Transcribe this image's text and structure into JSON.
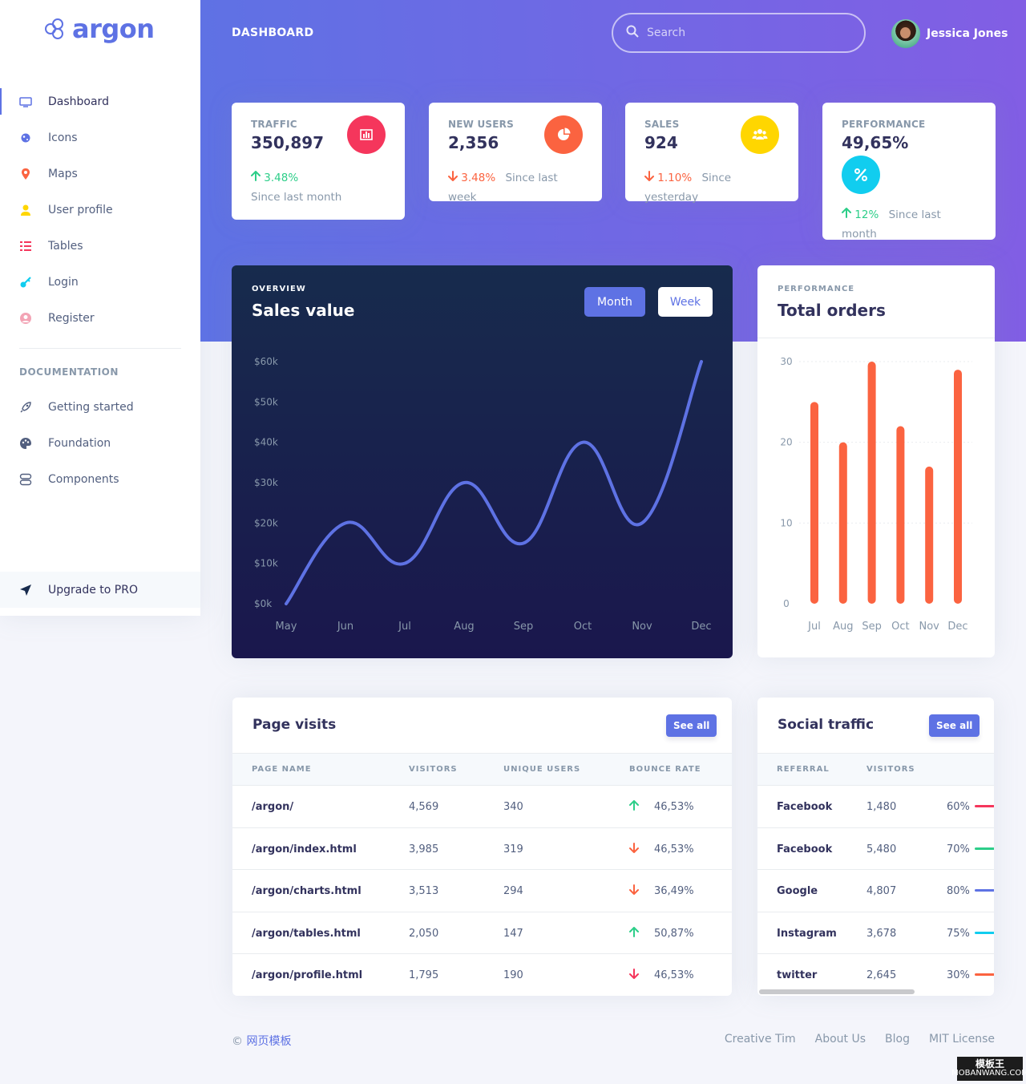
{
  "brand": {
    "name": "argon"
  },
  "sidebar": {
    "items": [
      {
        "label": "Dashboard",
        "icon": "tv-icon",
        "color": "#5e72e4",
        "active": true
      },
      {
        "label": "Icons",
        "icon": "planet-icon",
        "color": "#5e72e4"
      },
      {
        "label": "Maps",
        "icon": "pin-icon",
        "color": "#fb6340"
      },
      {
        "label": "User profile",
        "icon": "user-icon",
        "color": "#ffd600"
      },
      {
        "label": "Tables",
        "icon": "list-icon",
        "color": "#f5365c"
      },
      {
        "label": "Login",
        "icon": "key-icon",
        "color": "#11cdef"
      },
      {
        "label": "Register",
        "icon": "circle-user-icon",
        "color": "#f3a4b5"
      }
    ],
    "doc_heading": "DOCUMENTATION",
    "doc_items": [
      {
        "label": "Getting started",
        "icon": "rocket-icon"
      },
      {
        "label": "Foundation",
        "icon": "palette-icon"
      },
      {
        "label": "Components",
        "icon": "components-icon"
      }
    ],
    "upgrade": "Upgrade to PRO"
  },
  "header": {
    "title": "DASHBOARD",
    "search_placeholder": "Search",
    "user_name": "Jessica Jones"
  },
  "stats": [
    {
      "title": "TRAFFIC",
      "value": "350,897",
      "change": "3.48%",
      "direction": "up",
      "since": "Since last month",
      "icon": "chart-bar-icon",
      "color": "#f5365c"
    },
    {
      "title": "NEW USERS",
      "value": "2,356",
      "change": "3.48%",
      "direction": "down",
      "since": "Since last week",
      "icon": "chart-pie-icon",
      "color": "#fb6340"
    },
    {
      "title": "SALES",
      "value": "924",
      "change": "1.10%",
      "direction": "down",
      "since": "Since yesterday",
      "icon": "users-icon",
      "color": "#ffd600"
    },
    {
      "title": "PERFORMANCE",
      "value": "49,65%",
      "change": "12%",
      "direction": "up",
      "since": "Since last month",
      "icon": "percent-icon",
      "color": "#11cdef"
    }
  ],
  "sales_card": {
    "kicker": "OVERVIEW",
    "title": "Sales value",
    "btn_month": "Month",
    "btn_week": "Week"
  },
  "orders_card": {
    "kicker": "PERFORMANCE",
    "title": "Total orders"
  },
  "chart_data": [
    {
      "type": "line",
      "title": "Sales value",
      "categories": [
        "May",
        "Jun",
        "Jul",
        "Aug",
        "Sep",
        "Oct",
        "Nov",
        "Dec"
      ],
      "values": [
        0,
        20,
        10,
        30,
        15,
        40,
        20,
        60
      ],
      "y_ticks": [
        "$0k",
        "$10k",
        "$20k",
        "$30k",
        "$40k",
        "$50k",
        "$60k"
      ],
      "ylim": [
        0,
        60
      ],
      "color": "#5e72e4"
    },
    {
      "type": "bar",
      "title": "Total orders",
      "categories": [
        "Jul",
        "Aug",
        "Sep",
        "Oct",
        "Nov",
        "Dec"
      ],
      "values": [
        25,
        20,
        30,
        22,
        17,
        29
      ],
      "y_ticks": [
        "0",
        "10",
        "20",
        "30"
      ],
      "ylim": [
        0,
        30
      ],
      "color": "#fb6340"
    }
  ],
  "page_visits": {
    "title": "Page visits",
    "see_all": "See all",
    "columns": [
      "PAGE NAME",
      "VISITORS",
      "UNIQUE USERS",
      "BOUNCE RATE"
    ],
    "rows": [
      {
        "page": "/argon/",
        "visitors": "4,569",
        "unique": "340",
        "bounce": "46,53%",
        "dir": "up"
      },
      {
        "page": "/argon/index.html",
        "visitors": "3,985",
        "unique": "319",
        "bounce": "46,53%",
        "dir": "down-orange"
      },
      {
        "page": "/argon/charts.html",
        "visitors": "3,513",
        "unique": "294",
        "bounce": "36,49%",
        "dir": "down-orange"
      },
      {
        "page": "/argon/tables.html",
        "visitors": "2,050",
        "unique": "147",
        "bounce": "50,87%",
        "dir": "up"
      },
      {
        "page": "/argon/profile.html",
        "visitors": "1,795",
        "unique": "190",
        "bounce": "46,53%",
        "dir": "down"
      }
    ]
  },
  "social_traffic": {
    "title": "Social traffic",
    "see_all": "See all",
    "columns": [
      "REFERRAL",
      "VISITORS"
    ],
    "rows": [
      {
        "referral": "Facebook",
        "visitors": "1,480",
        "percent": "60%",
        "color": "#f5365c"
      },
      {
        "referral": "Facebook",
        "visitors": "5,480",
        "percent": "70%",
        "color": "#2dce89"
      },
      {
        "referral": "Google",
        "visitors": "4,807",
        "percent": "80%",
        "color": "#5e72e4"
      },
      {
        "referral": "Instagram",
        "visitors": "3,678",
        "percent": "75%",
        "color": "#11cdef"
      },
      {
        "referral": "twitter",
        "visitors": "2,645",
        "percent": "30%",
        "color": "#fb6340"
      }
    ]
  },
  "footer": {
    "copyright": "©",
    "brand_link": "网页模板",
    "links": [
      "Creative Tim",
      "About Us",
      "Blog",
      "MIT License"
    ]
  },
  "watermark": {
    "top": "模板王",
    "bottom": "MOBANWANG.COM"
  }
}
